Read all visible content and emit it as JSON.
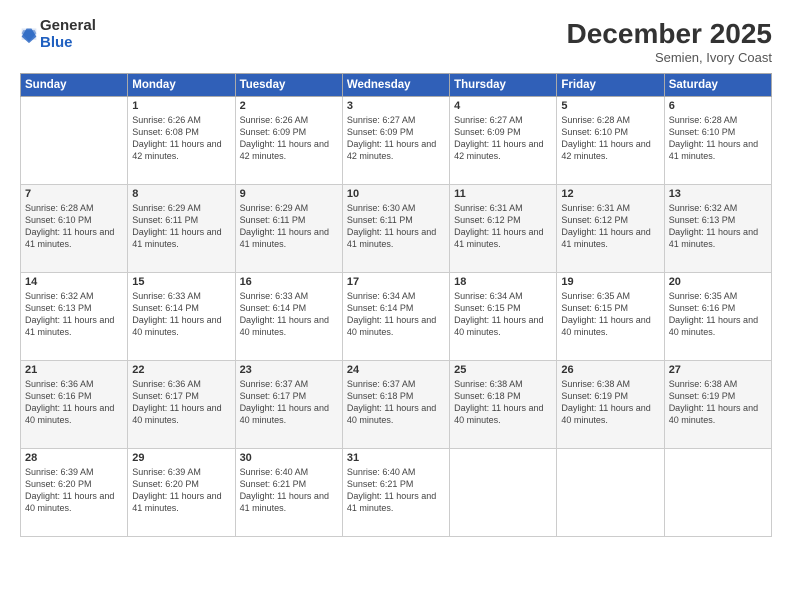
{
  "logo": {
    "general": "General",
    "blue": "Blue"
  },
  "header": {
    "month": "December 2025",
    "location": "Semien, Ivory Coast"
  },
  "weekdays": [
    "Sunday",
    "Monday",
    "Tuesday",
    "Wednesday",
    "Thursday",
    "Friday",
    "Saturday"
  ],
  "weeks": [
    [
      {
        "day": "",
        "sunrise": "",
        "sunset": "",
        "daylight": ""
      },
      {
        "day": "1",
        "sunrise": "Sunrise: 6:26 AM",
        "sunset": "Sunset: 6:08 PM",
        "daylight": "Daylight: 11 hours and 42 minutes."
      },
      {
        "day": "2",
        "sunrise": "Sunrise: 6:26 AM",
        "sunset": "Sunset: 6:09 PM",
        "daylight": "Daylight: 11 hours and 42 minutes."
      },
      {
        "day": "3",
        "sunrise": "Sunrise: 6:27 AM",
        "sunset": "Sunset: 6:09 PM",
        "daylight": "Daylight: 11 hours and 42 minutes."
      },
      {
        "day": "4",
        "sunrise": "Sunrise: 6:27 AM",
        "sunset": "Sunset: 6:09 PM",
        "daylight": "Daylight: 11 hours and 42 minutes."
      },
      {
        "day": "5",
        "sunrise": "Sunrise: 6:28 AM",
        "sunset": "Sunset: 6:10 PM",
        "daylight": "Daylight: 11 hours and 42 minutes."
      },
      {
        "day": "6",
        "sunrise": "Sunrise: 6:28 AM",
        "sunset": "Sunset: 6:10 PM",
        "daylight": "Daylight: 11 hours and 41 minutes."
      }
    ],
    [
      {
        "day": "7",
        "sunrise": "Sunrise: 6:28 AM",
        "sunset": "Sunset: 6:10 PM",
        "daylight": "Daylight: 11 hours and 41 minutes."
      },
      {
        "day": "8",
        "sunrise": "Sunrise: 6:29 AM",
        "sunset": "Sunset: 6:11 PM",
        "daylight": "Daylight: 11 hours and 41 minutes."
      },
      {
        "day": "9",
        "sunrise": "Sunrise: 6:29 AM",
        "sunset": "Sunset: 6:11 PM",
        "daylight": "Daylight: 11 hours and 41 minutes."
      },
      {
        "day": "10",
        "sunrise": "Sunrise: 6:30 AM",
        "sunset": "Sunset: 6:11 PM",
        "daylight": "Daylight: 11 hours and 41 minutes."
      },
      {
        "day": "11",
        "sunrise": "Sunrise: 6:31 AM",
        "sunset": "Sunset: 6:12 PM",
        "daylight": "Daylight: 11 hours and 41 minutes."
      },
      {
        "day": "12",
        "sunrise": "Sunrise: 6:31 AM",
        "sunset": "Sunset: 6:12 PM",
        "daylight": "Daylight: 11 hours and 41 minutes."
      },
      {
        "day": "13",
        "sunrise": "Sunrise: 6:32 AM",
        "sunset": "Sunset: 6:13 PM",
        "daylight": "Daylight: 11 hours and 41 minutes."
      }
    ],
    [
      {
        "day": "14",
        "sunrise": "Sunrise: 6:32 AM",
        "sunset": "Sunset: 6:13 PM",
        "daylight": "Daylight: 11 hours and 41 minutes."
      },
      {
        "day": "15",
        "sunrise": "Sunrise: 6:33 AM",
        "sunset": "Sunset: 6:14 PM",
        "daylight": "Daylight: 11 hours and 40 minutes."
      },
      {
        "day": "16",
        "sunrise": "Sunrise: 6:33 AM",
        "sunset": "Sunset: 6:14 PM",
        "daylight": "Daylight: 11 hours and 40 minutes."
      },
      {
        "day": "17",
        "sunrise": "Sunrise: 6:34 AM",
        "sunset": "Sunset: 6:14 PM",
        "daylight": "Daylight: 11 hours and 40 minutes."
      },
      {
        "day": "18",
        "sunrise": "Sunrise: 6:34 AM",
        "sunset": "Sunset: 6:15 PM",
        "daylight": "Daylight: 11 hours and 40 minutes."
      },
      {
        "day": "19",
        "sunrise": "Sunrise: 6:35 AM",
        "sunset": "Sunset: 6:15 PM",
        "daylight": "Daylight: 11 hours and 40 minutes."
      },
      {
        "day": "20",
        "sunrise": "Sunrise: 6:35 AM",
        "sunset": "Sunset: 6:16 PM",
        "daylight": "Daylight: 11 hours and 40 minutes."
      }
    ],
    [
      {
        "day": "21",
        "sunrise": "Sunrise: 6:36 AM",
        "sunset": "Sunset: 6:16 PM",
        "daylight": "Daylight: 11 hours and 40 minutes."
      },
      {
        "day": "22",
        "sunrise": "Sunrise: 6:36 AM",
        "sunset": "Sunset: 6:17 PM",
        "daylight": "Daylight: 11 hours and 40 minutes."
      },
      {
        "day": "23",
        "sunrise": "Sunrise: 6:37 AM",
        "sunset": "Sunset: 6:17 PM",
        "daylight": "Daylight: 11 hours and 40 minutes."
      },
      {
        "day": "24",
        "sunrise": "Sunrise: 6:37 AM",
        "sunset": "Sunset: 6:18 PM",
        "daylight": "Daylight: 11 hours and 40 minutes."
      },
      {
        "day": "25",
        "sunrise": "Sunrise: 6:38 AM",
        "sunset": "Sunset: 6:18 PM",
        "daylight": "Daylight: 11 hours and 40 minutes."
      },
      {
        "day": "26",
        "sunrise": "Sunrise: 6:38 AM",
        "sunset": "Sunset: 6:19 PM",
        "daylight": "Daylight: 11 hours and 40 minutes."
      },
      {
        "day": "27",
        "sunrise": "Sunrise: 6:38 AM",
        "sunset": "Sunset: 6:19 PM",
        "daylight": "Daylight: 11 hours and 40 minutes."
      }
    ],
    [
      {
        "day": "28",
        "sunrise": "Sunrise: 6:39 AM",
        "sunset": "Sunset: 6:20 PM",
        "daylight": "Daylight: 11 hours and 40 minutes."
      },
      {
        "day": "29",
        "sunrise": "Sunrise: 6:39 AM",
        "sunset": "Sunset: 6:20 PM",
        "daylight": "Daylight: 11 hours and 41 minutes."
      },
      {
        "day": "30",
        "sunrise": "Sunrise: 6:40 AM",
        "sunset": "Sunset: 6:21 PM",
        "daylight": "Daylight: 11 hours and 41 minutes."
      },
      {
        "day": "31",
        "sunrise": "Sunrise: 6:40 AM",
        "sunset": "Sunset: 6:21 PM",
        "daylight": "Daylight: 11 hours and 41 minutes."
      },
      {
        "day": "",
        "sunrise": "",
        "sunset": "",
        "daylight": ""
      },
      {
        "day": "",
        "sunrise": "",
        "sunset": "",
        "daylight": ""
      },
      {
        "day": "",
        "sunrise": "",
        "sunset": "",
        "daylight": ""
      }
    ]
  ]
}
